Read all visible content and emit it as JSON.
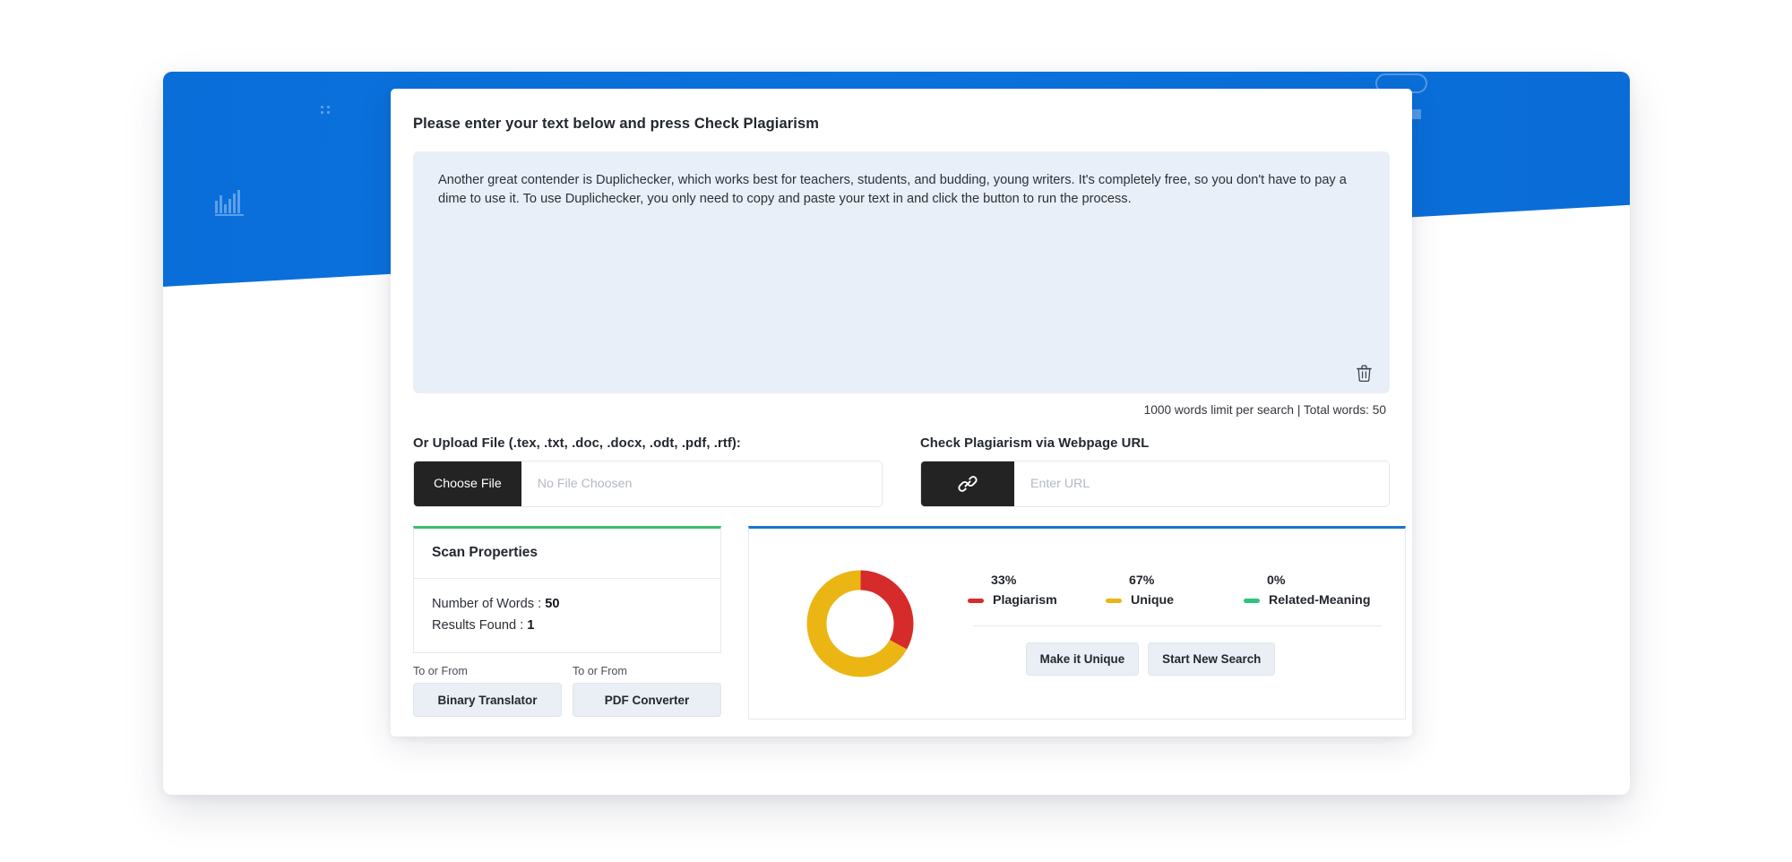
{
  "card": {
    "title": "Please enter your text below and press Check Plagiarism",
    "editor_text": "Another great contender is Duplichecker, which works best for teachers, students, and budding, young writers. It's completely free, so you don't have to pay a dime to use it. To use Duplichecker, you only need to copy and paste your text in and click the button to run the process.",
    "trash_icon": "trash-icon",
    "word_limit_note": "1000 words limit per search | Total words: 50"
  },
  "upload": {
    "label": "Or Upload File (.tex, .txt, .doc, .docx, .odt, .pdf, .rtf):",
    "button_label": "Choose File",
    "file_placeholder": "No File Choosen"
  },
  "url_check": {
    "label": "Check Plagiarism via Webpage URL",
    "icon": "link-icon",
    "url_placeholder": "Enter URL"
  },
  "scan_properties": {
    "heading": "Scan Properties",
    "accent_color": "#3bbd6e",
    "rows": [
      {
        "label": "Number of Words :",
        "value": "50"
      },
      {
        "label": "Results Found :",
        "value": "1"
      }
    ],
    "tools": [
      {
        "caption": "To or From",
        "label": "Binary Translator"
      },
      {
        "caption": "To or From",
        "label": "PDF Converter"
      }
    ]
  },
  "results": {
    "accent_color": "#1975d1",
    "actions": [
      {
        "label": "Make it Unique"
      },
      {
        "label": "Start New Search"
      }
    ]
  },
  "chart_data": {
    "type": "pie",
    "title": "",
    "variant": "donut",
    "categories": [
      "Plagiarism",
      "Unique",
      "Related-Meaning"
    ],
    "values": [
      33,
      67,
      0
    ],
    "value_labels": [
      "33%",
      "67%",
      "0%"
    ],
    "colors": [
      "#d62b2b",
      "#ebb514",
      "#2fc479"
    ],
    "unit": "%",
    "legend_position": "right",
    "start_angle_deg": 0,
    "direction": "clockwise",
    "inner_radius_ratio": 0.56
  },
  "decor": {
    "banner_color": "#0b74e0",
    "bars_icon": "bar-chart-icon",
    "square_icon": "square-dot-icon",
    "dots_icon": "dots-icon",
    "oval_icon": "oval-outline-icon"
  }
}
